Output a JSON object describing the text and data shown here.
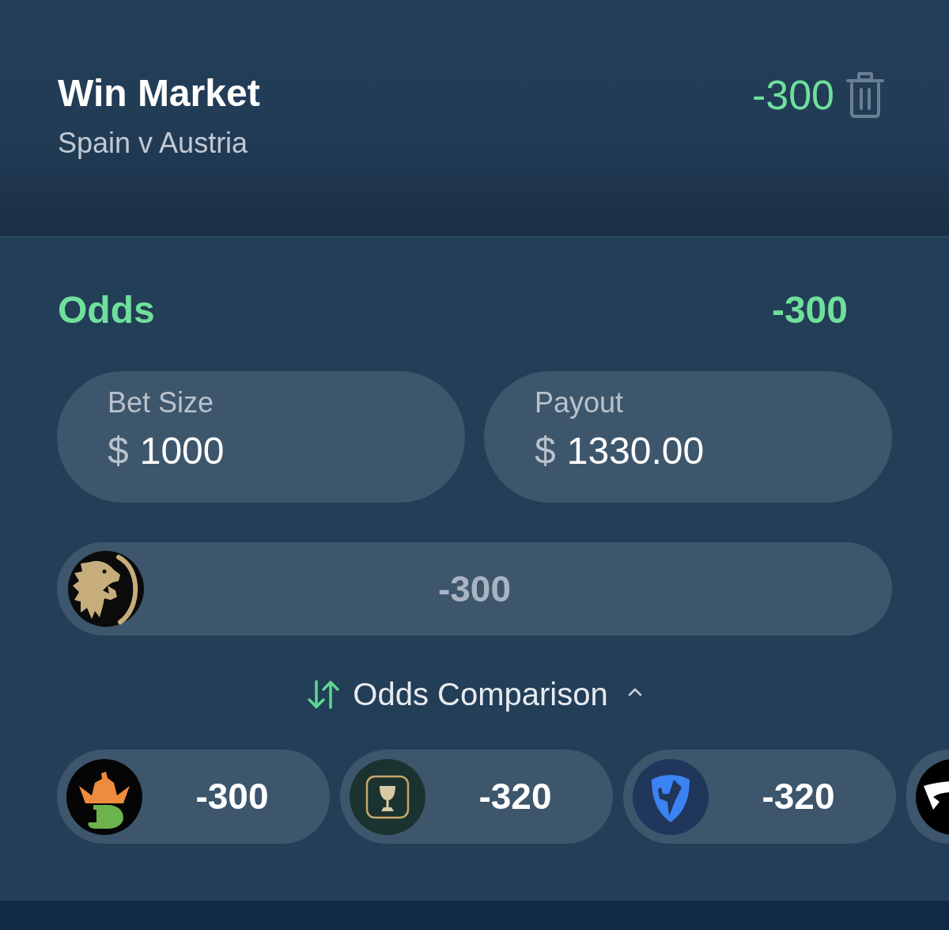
{
  "bet": {
    "market": "Win Market",
    "event": "Spain v Austria",
    "odds": "-300"
  },
  "odds_row": {
    "label": "Odds",
    "value": "-300"
  },
  "fields": [
    {
      "label": "Bet Size",
      "currency": "$",
      "value": "1000"
    },
    {
      "label": "Payout",
      "currency": "$",
      "value": "1330.00"
    }
  ],
  "sportsbook": {
    "kind": "lion",
    "odds": "-300"
  },
  "comparison": {
    "label": "Odds Comparison",
    "expanded": true,
    "books": [
      {
        "kind": "crown",
        "odds": "-300"
      },
      {
        "kind": "goblet",
        "odds": "-320"
      },
      {
        "kind": "shield",
        "odds": "-320"
      },
      {
        "kind": "wedge"
      }
    ]
  }
}
